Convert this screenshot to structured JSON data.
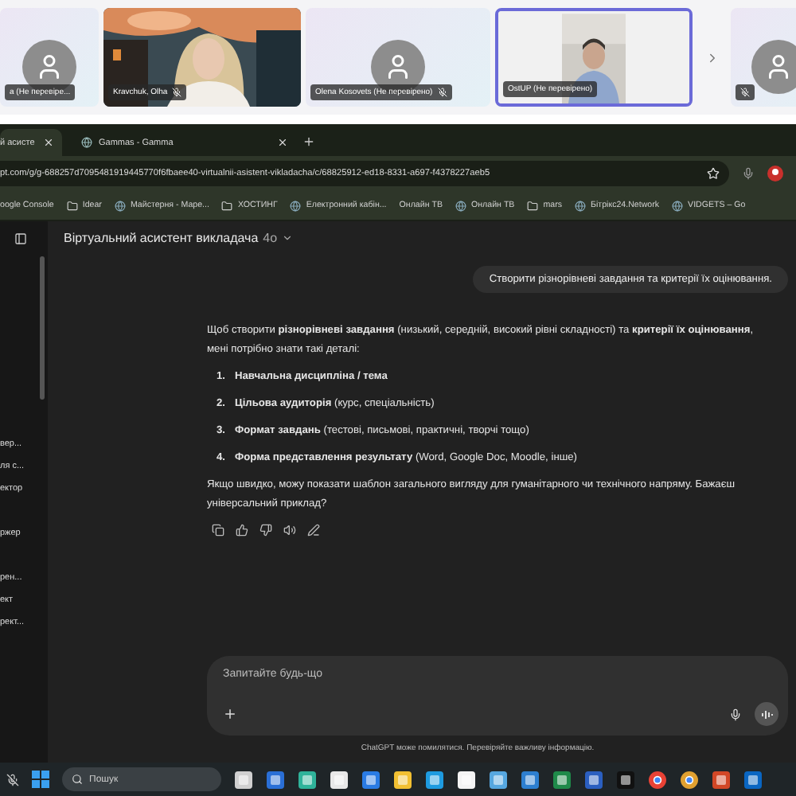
{
  "call": {
    "participants": [
      {
        "kind": "avatar",
        "name": "а (Не перевіре...",
        "muted": false,
        "selected": false
      },
      {
        "kind": "video",
        "name": "Kravchuk, Olha",
        "muted": true,
        "selected": false
      },
      {
        "kind": "avatar",
        "name": "Olena Kosovets (Не перевірено)",
        "muted": true,
        "selected": false
      },
      {
        "kind": "video",
        "name": "OstUP (Не перевірено)",
        "muted": false,
        "selected": true
      }
    ],
    "next_page": [
      {
        "kind": "avatar",
        "muted": true,
        "selected": false
      }
    ]
  },
  "browser": {
    "tabs": [
      {
        "label": "й асисте",
        "selected": true
      },
      {
        "label": "Gammas - Gamma",
        "selected": false
      }
    ],
    "url": "pt.com/g/g-688257d7095481919445770f6fbaee40-virtualnii-asistent-vikladacha/c/68825912-ed18-8331-a697-f4378227aeb5",
    "bookmarks": [
      {
        "kind": "plain",
        "label": "oogle Console"
      },
      {
        "kind": "folder",
        "label": "Idear"
      },
      {
        "kind": "site",
        "label": "Майстерня - Маре..."
      },
      {
        "kind": "folder",
        "label": "ХОСТИНГ"
      },
      {
        "kind": "site",
        "label": "Електронний кабін..."
      },
      {
        "kind": "plain",
        "label": "Онлайн ТВ"
      },
      {
        "kind": "site",
        "label": "Онлайн ТВ"
      },
      {
        "kind": "folder",
        "label": "mars"
      },
      {
        "kind": "site",
        "label": "Бітрікс24.Network"
      },
      {
        "kind": "site",
        "label": "VIDGETS – Go"
      }
    ]
  },
  "chat": {
    "sidebar_groups": [
      {
        "items": [
          "вер...",
          "ля с...",
          "ектор"
        ]
      },
      {
        "items": [
          "ржер"
        ]
      },
      {
        "items": [
          "рен...",
          "ект",
          "рект..."
        ]
      }
    ],
    "title": "Віртуальний асистент викладача",
    "model": "4о",
    "user_message": "Створити різнорівневі завдання та критерії їх оцінювання.",
    "response": {
      "intro": "Щоб створити **різнорівневі завдання** (низький, середній, високий рівні складності) та **критерії їх оцінювання**, мені потрібно знати такі деталі:",
      "items": [
        {
          "number": "1.",
          "text": "**Навчальна дисципліна / тема**"
        },
        {
          "number": "2.",
          "text": "**Цільова аудиторія** (курс, спеціальність)"
        },
        {
          "number": "3.",
          "text": "**Формат завдань** (тестові, письмові, практичні, творчі тощо)"
        },
        {
          "number": "4.",
          "text": "**Форма представлення результату** (Word, Google Doc, Moodle, інше)"
        }
      ],
      "outro": "Якщо швидко, можу показати шаблон загального вигляду для гуманітарного чи технічного напряму. Бажаєш універсальний приклад?"
    },
    "input": {
      "placeholder": "Запитайте будь-що"
    },
    "disclaimer": "ChatGPT може помилятися. Перевіряйте важливу інформацію."
  },
  "taskbar": {
    "search": {
      "placeholder": "Пошук"
    }
  }
}
